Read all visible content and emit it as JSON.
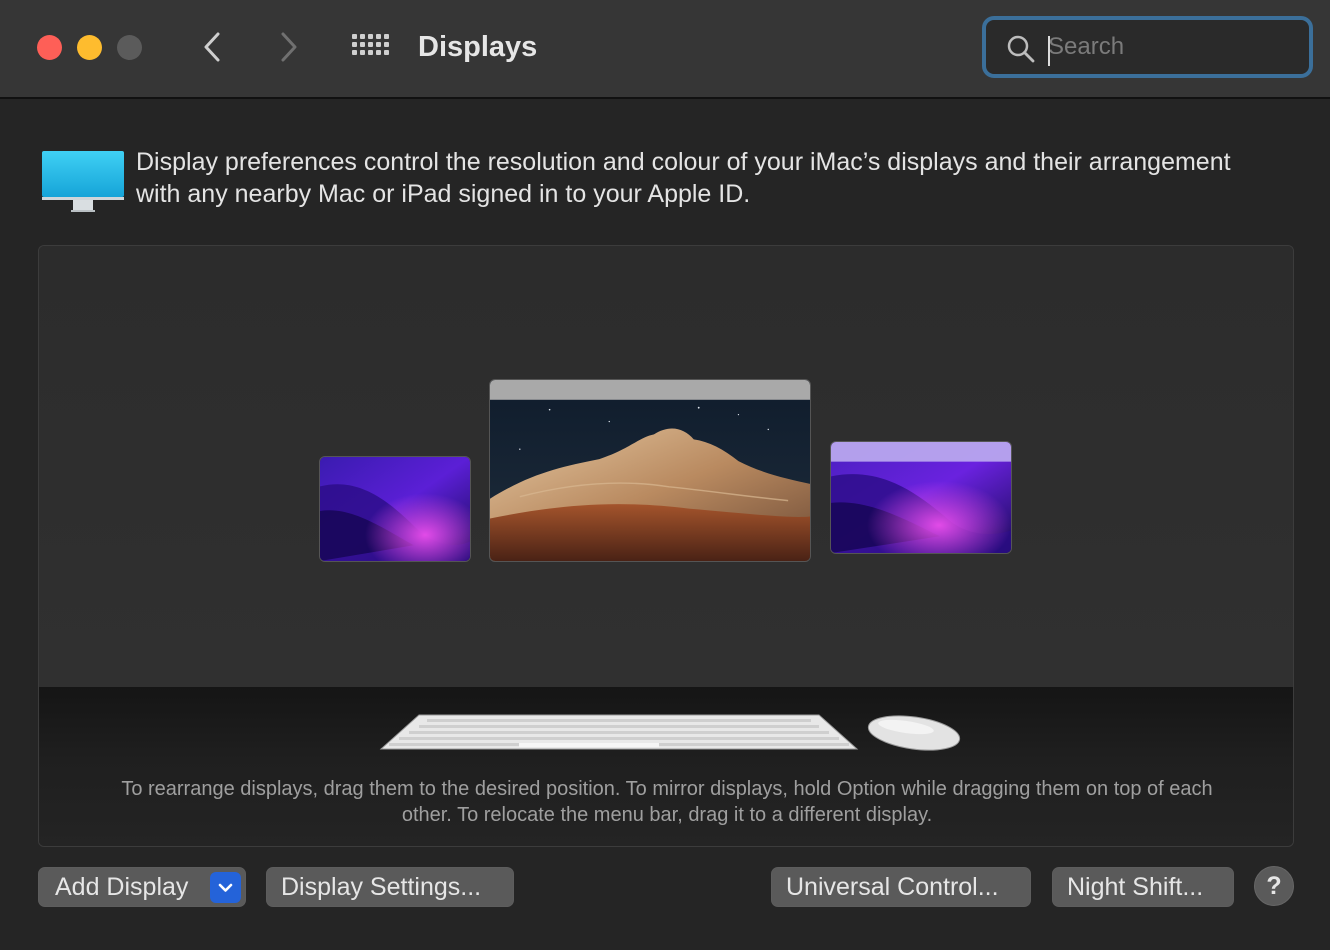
{
  "window": {
    "title": "Displays",
    "traffic_lights": {
      "close": "#fe5f57",
      "minimize": "#febc2e",
      "zoom": "#5b5b5b"
    }
  },
  "toolbar": {
    "back_icon": "chevron-left-icon",
    "forward_icon": "chevron-right-icon",
    "grid_icon": "grid-icon"
  },
  "search": {
    "placeholder": "Search",
    "value": ""
  },
  "header": {
    "description": "Display preferences control the resolution and colour of your iMac’s displays and their arrangement with any nearby Mac or iPad signed in to your Apple ID."
  },
  "arrangement": {
    "displays": [
      "display-left",
      "display-main",
      "display-right"
    ],
    "instructions": "To rearrange displays, drag them to the desired position. To mirror displays, hold Option while dragging them on top of each other. To relocate the menu bar, drag it to a different display."
  },
  "buttons": {
    "add_display": "Add Display",
    "display_settings": "Display Settings...",
    "universal_control": "Universal Control...",
    "night_shift": "Night Shift...",
    "help": "?"
  },
  "colors": {
    "accent": "#2463d9",
    "search_focus": "#3b6f9a"
  }
}
